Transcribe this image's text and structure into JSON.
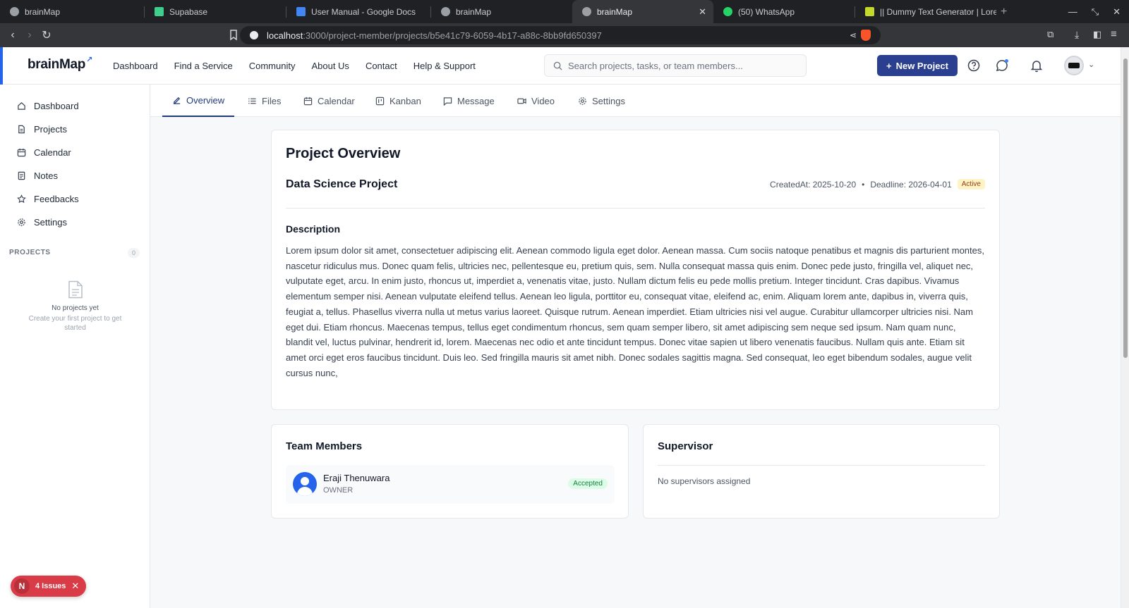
{
  "browser": {
    "tabs": [
      {
        "title": "brainMap",
        "color": "#9aa0a6"
      },
      {
        "title": "Supabase",
        "color": "#3ecf8e"
      },
      {
        "title": "User Manual - Google Docs",
        "color": "#4285f4"
      },
      {
        "title": "brainMap",
        "color": "#9aa0a6"
      },
      {
        "title": "brainMap",
        "color": "#9aa0a6"
      },
      {
        "title": "(50) WhatsApp",
        "color": "#25d366"
      },
      {
        "title": "|| Dummy Text Generator | Lore",
        "color": "#c5d92c"
      }
    ],
    "url_host": "localhost",
    "url_path": ":3000/project-member/projects/b5e41c79-6059-4b17-a88c-8bb9fd650397"
  },
  "header": {
    "logo": "brainMap",
    "nav": [
      "Dashboard",
      "Find a Service",
      "Community",
      "About Us",
      "Contact",
      "Help & Support"
    ],
    "search_placeholder": "Search projects, tasks, or team members...",
    "new_project": "New Project"
  },
  "sidebar": {
    "items": [
      "Dashboard",
      "Projects",
      "Calendar",
      "Notes",
      "Feedbacks",
      "Settings"
    ],
    "projects_heading": "PROJECTS",
    "projects_count": "0",
    "empty_title": "No projects yet",
    "empty_sub": "Create your first project to get started"
  },
  "tabs": [
    "Overview",
    "Files",
    "Calendar",
    "Kanban",
    "Message",
    "Video",
    "Settings"
  ],
  "overview": {
    "title": "Project Overview",
    "project_name": "Data Science Project",
    "created": "CreatedAt: 2025-10-20",
    "bullet": "•",
    "deadline": "Deadline: 2026-04-01",
    "status": "Active",
    "description_title": "Description",
    "description": "Lorem ipsum dolor sit amet, consectetuer adipiscing elit. Aenean commodo ligula eget dolor. Aenean massa. Cum sociis natoque penatibus et magnis dis parturient montes, nascetur ridiculus mus. Donec quam felis, ultricies nec, pellentesque eu, pretium quis, sem. Nulla consequat massa quis enim. Donec pede justo, fringilla vel, aliquet nec, vulputate eget, arcu. In enim justo, rhoncus ut, imperdiet a, venenatis vitae, justo. Nullam dictum felis eu pede mollis pretium. Integer tincidunt. Cras dapibus. Vivamus elementum semper nisi. Aenean vulputate eleifend tellus. Aenean leo ligula, porttitor eu, consequat vitae, eleifend ac, enim. Aliquam lorem ante, dapibus in, viverra quis, feugiat a, tellus. Phasellus viverra nulla ut metus varius laoreet. Quisque rutrum. Aenean imperdiet. Etiam ultricies nisi vel augue. Curabitur ullamcorper ultricies nisi. Nam eget dui. Etiam rhoncus. Maecenas tempus, tellus eget condimentum rhoncus, sem quam semper libero, sit amet adipiscing sem neque sed ipsum. Nam quam nunc, blandit vel, luctus pulvinar, hendrerit id, lorem. Maecenas nec odio et ante tincidunt tempus. Donec vitae sapien ut libero venenatis faucibus. Nullam quis ante. Etiam sit amet orci eget eros faucibus tincidunt. Duis leo. Sed fringilla mauris sit amet nibh. Donec sodales sagittis magna. Sed consequat, leo eget bibendum sodales, augue velit cursus nunc,"
  },
  "team": {
    "title": "Team Members",
    "members": [
      {
        "name": "Eraji Thenuwara",
        "role": "OWNER",
        "status": "Accepted"
      }
    ]
  },
  "supervisor": {
    "title": "Supervisor",
    "empty": "No supervisors assigned"
  },
  "issues": {
    "letter": "N",
    "label": "4 Issues"
  },
  "colors": {
    "accent": "#2563eb",
    "primary_button": "#2a3f8f",
    "active_badge": "#fef3c7",
    "accepted_badge": "#dcfce7",
    "issues_badge": "#d93b47"
  }
}
